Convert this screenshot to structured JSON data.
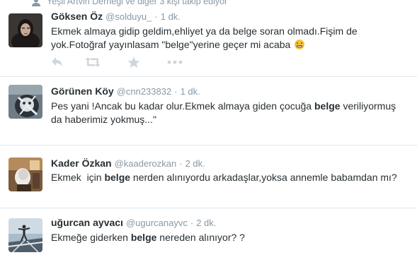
{
  "context": {
    "icon": "person-icon",
    "text": "Yeşil Artvin Derneği ve diğer 3 kişi takip ediyor"
  },
  "colors": {
    "name": "#292f33",
    "meta": "#8899a6",
    "divider": "#e1e8ed",
    "action_icon": "#ccd6dd"
  },
  "actions": [
    "reply-icon",
    "retweet-icon",
    "favorite-icon",
    "more-icon"
  ],
  "tweets": [
    {
      "name": "Göksen Öz",
      "username": "@solduyu_",
      "separator": "·",
      "time": "1 dk.",
      "text_parts": [
        {
          "text": "Ekmek almaya gidip geldim,ehliyet ya da belge soran olmadı.Fişim de yok.Fotoğraf yayınlasam \"belge\"yerine geçer mi acaba",
          "bold": false
        }
      ],
      "emoji": "grimacing-face-icon"
    },
    {
      "name": "Görünen Köy",
      "username": "@cnn233832",
      "separator": "·",
      "time": "1 dk.",
      "text_parts": [
        {
          "text": "Pes yani !Ancak bu kadar olur.Ekmek almaya giden çocuğa ",
          "bold": false
        },
        {
          "text": "belge",
          "bold": true
        },
        {
          "text": " veriliyormuş da haberimiz yokmuş...\"",
          "bold": false
        }
      ]
    },
    {
      "name": "Kader Özkan",
      "username": "@kaaderozkan",
      "separator": "·",
      "time": "2 dk.",
      "text_parts": [
        {
          "text": "Ekmek  için ",
          "bold": false
        },
        {
          "text": "belge",
          "bold": true
        },
        {
          "text": " nerden alınıyordu arkadaşlar,yoksa annemle babamdan mı?",
          "bold": false
        }
      ]
    },
    {
      "name": "uğurcan ayvacı",
      "username": "@ugurcanayvc",
      "separator": "·",
      "time": "2 dk.",
      "text_parts": [
        {
          "text": "Ekmeğe giderken ",
          "bold": false
        },
        {
          "text": "belge",
          "bold": true
        },
        {
          "text": " nereden alınıyor? ?",
          "bold": false
        }
      ]
    }
  ]
}
